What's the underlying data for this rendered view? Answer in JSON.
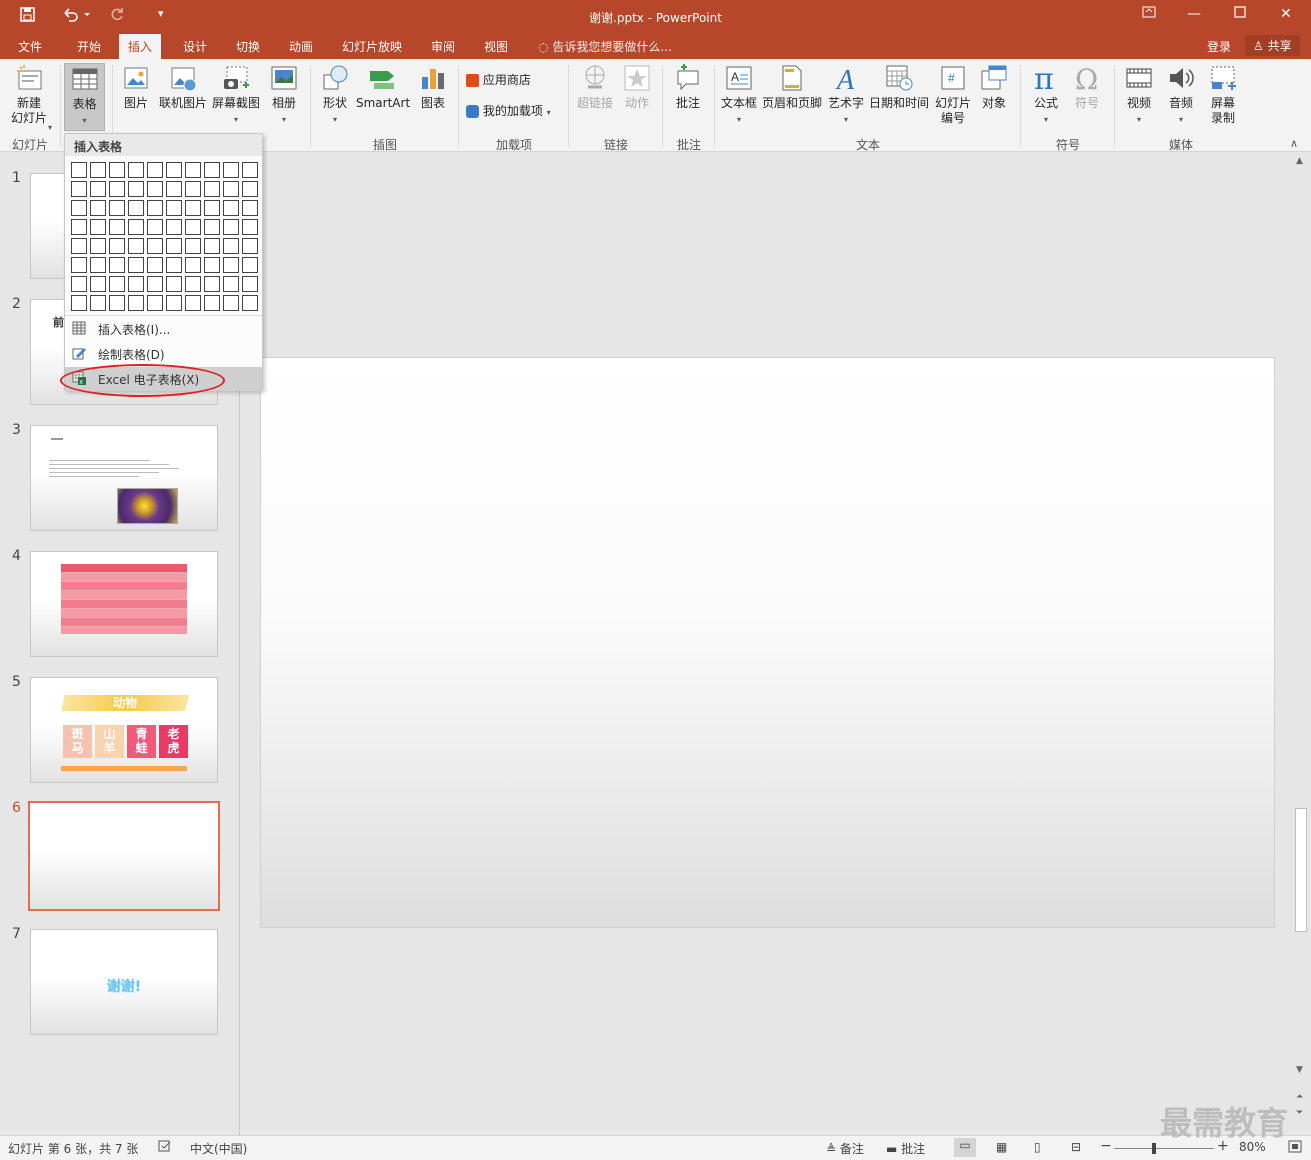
{
  "titlebar": {
    "title": "谢谢.pptx - PowerPoint"
  },
  "tabs": [
    "文件",
    "开始",
    "插入",
    "设计",
    "切换",
    "动画",
    "幻灯片放映",
    "审阅",
    "视图"
  ],
  "active_tab": "插入",
  "tellme": "告诉我您想要做什么...",
  "signin": "登录",
  "share": "共享",
  "ribbon": {
    "new_slide": "新建\n幻灯片",
    "table": "表格",
    "picture": "图片",
    "online_picture": "联机图片",
    "screenshot": "屏幕截图",
    "album": "相册",
    "shapes": "形状",
    "smartart": "SmartArt",
    "chart": "图表",
    "store": "应用商店",
    "my_addins": "我的加载项",
    "hyperlink": "超链接",
    "action": "动作",
    "comment": "批注",
    "textbox": "文本框",
    "header_footer": "页眉和页脚",
    "wordart": "艺术字",
    "datetime": "日期和时间",
    "slide_number": "幻灯片\n编号",
    "object": "对象",
    "equation": "公式",
    "symbol": "符号",
    "video": "视频",
    "audio": "音频",
    "screen_recording": "屏幕\n录制",
    "groups": [
      "幻灯片",
      "插图",
      "加载项",
      "链接",
      "批注",
      "文本",
      "符号",
      "媒体"
    ]
  },
  "dropdown": {
    "header": "插入表格",
    "items": [
      {
        "label": "插入表格(I)..."
      },
      {
        "label": "绘制表格(D)"
      },
      {
        "label": "Excel 电子表格(X)"
      }
    ]
  },
  "slides": [
    {
      "number": "1"
    },
    {
      "number": "2",
      "snippet": "前"
    },
    {
      "number": "3"
    },
    {
      "number": "4"
    },
    {
      "number": "5",
      "title": "动物",
      "chars": [
        "斑马",
        "山羊",
        "青蛙",
        "老虎"
      ]
    },
    {
      "number": "6",
      "current": true
    },
    {
      "number": "7",
      "text": "谢谢!"
    }
  ],
  "status": {
    "slide_info": "幻灯片 第 6 张，共 7 张",
    "language": "中文(中国)",
    "notes": "备注",
    "comments": "批注",
    "zoom": "80%"
  },
  "watermark": "最需教育",
  "colors": {
    "accent": "#b7472a",
    "selection": "#e76b4e",
    "highlight_oval": "#e02020"
  }
}
